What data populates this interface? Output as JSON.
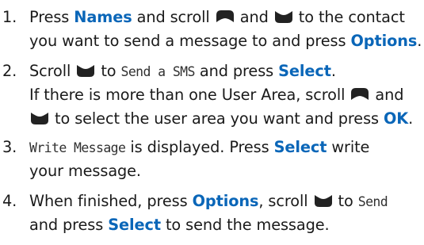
{
  "steps": [
    {
      "number": "1.",
      "line1": {
        "t1": "Press ",
        "k1": "Names",
        "t2": " and scroll ",
        "i1": "scroll-up-key-icon",
        "t3": " and ",
        "i2": "scroll-down-key-icon",
        "t4": " to the contact"
      },
      "line2": {
        "t1": "you want to send a message to and press ",
        "k1": "Options",
        "t2": "."
      }
    },
    {
      "number": "2.",
      "line1": {
        "t1": "Scroll ",
        "i1": "scroll-down-key-icon",
        "t2": " to ",
        "d1": "Send a SMS",
        "t3": " and press ",
        "k1": "Select",
        "t4": "."
      },
      "line2": {
        "t1": "If there is more than one User Area, scroll ",
        "i1": "scroll-up-key-icon",
        "t2": " and"
      },
      "line3": {
        "i1": "scroll-down-key-icon",
        "t1": " to select the user area you want and press ",
        "k1": "OK",
        "t2": "."
      }
    },
    {
      "number": "3.",
      "line1": {
        "d1": "Write Message",
        "t1": " is displayed. Press ",
        "k1": "Select",
        "t2": " write"
      },
      "line2": {
        "t1": "your message."
      }
    },
    {
      "number": "4.",
      "line1": {
        "t1": "When finished, press ",
        "k1": "Options",
        "t2": ", scroll ",
        "i1": "scroll-down-key-icon",
        "t3": " to ",
        "d1": "Send"
      },
      "line2": {
        "t1": "and press ",
        "k1": "Select",
        "t2": " to send the message."
      }
    }
  ],
  "colors": {
    "keyword": "#0a66b8",
    "text": "#1a1a1a",
    "key_icon": "#222222"
  }
}
